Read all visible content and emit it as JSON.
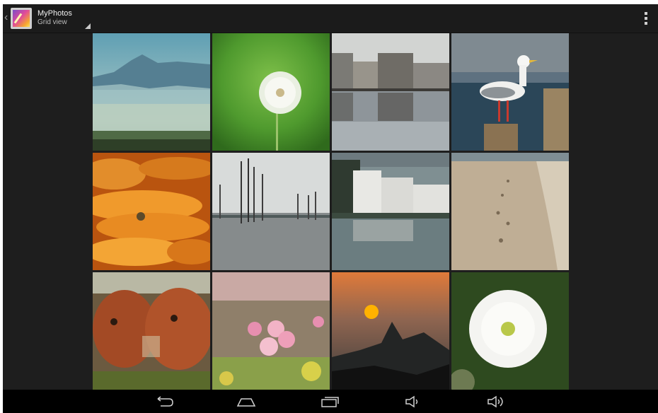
{
  "action_bar": {
    "app_title": "MyPhotos",
    "view_label": "Grid view",
    "icons": [
      "up-caret-icon",
      "app-icon",
      "overflow-menu-icon"
    ]
  },
  "grid": {
    "columns": 4,
    "rows": 3,
    "photos": [
      {
        "subject": "misty-mountain-landscape"
      },
      {
        "subject": "dandelion-seedhead"
      },
      {
        "subject": "village-reflection-in-water"
      },
      {
        "subject": "seagull-on-post"
      },
      {
        "subject": "corn-cobs"
      },
      {
        "subject": "bare-trees-in-lake"
      },
      {
        "subject": "white-houses-by-lake"
      },
      {
        "subject": "footprints-on-beach"
      },
      {
        "subject": "oxen"
      },
      {
        "subject": "peach-blossoms"
      },
      {
        "subject": "sunset-over-peaks"
      },
      {
        "subject": "white-daisy-flower"
      }
    ]
  },
  "nav_bar": {
    "icons": [
      "back-icon",
      "home-icon",
      "recent-apps-icon",
      "volume-down-icon",
      "volume-up-icon"
    ]
  },
  "colors": {
    "background": "#1e1e1e",
    "action_bar": "#1b1b1b",
    "nav_bar": "#000000"
  }
}
